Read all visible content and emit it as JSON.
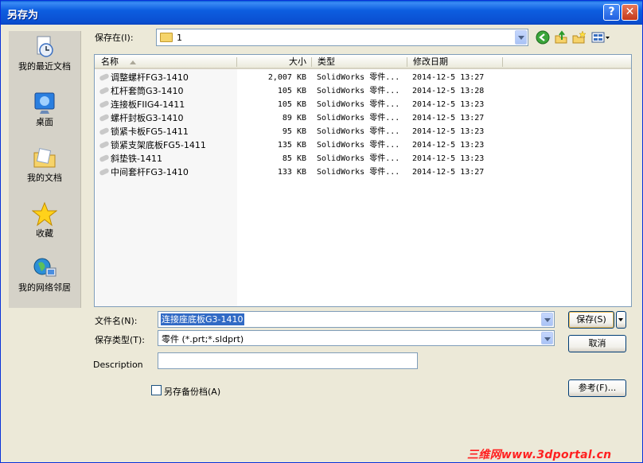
{
  "window": {
    "title": "另存为",
    "help": "?",
    "close": "✕"
  },
  "places": [
    {
      "id": "recent",
      "label": "我的最近文档"
    },
    {
      "id": "desktop",
      "label": "桌面"
    },
    {
      "id": "mydocs",
      "label": "我的文档"
    },
    {
      "id": "favorites",
      "label": "收藏"
    },
    {
      "id": "network",
      "label": "我的网络邻居"
    }
  ],
  "save_in": {
    "label": "保存在(I):",
    "value": "1"
  },
  "toolbar_icons": [
    "back-icon",
    "up-folder-icon",
    "new-folder-icon",
    "views-menu-icon"
  ],
  "columns": {
    "name": "名称",
    "size": "大小",
    "type": "类型",
    "modified": "修改日期"
  },
  "files": [
    {
      "name": "调整螺杆FG3-1410",
      "size": "2,007 KB",
      "type": "SolidWorks 零件...",
      "date": "2014-12-5 13:27"
    },
    {
      "name": "杠杆套筒G3-1410",
      "size": "105 KB",
      "type": "SolidWorks 零件...",
      "date": "2014-12-5 13:28"
    },
    {
      "name": "连接板FIIG4-1411",
      "size": "105 KB",
      "type": "SolidWorks 零件...",
      "date": "2014-12-5 13:23"
    },
    {
      "name": "螺杆封板G3-1410",
      "size": "89 KB",
      "type": "SolidWorks 零件...",
      "date": "2014-12-5 13:27"
    },
    {
      "name": "锁紧卡板FG5-1411",
      "size": "95 KB",
      "type": "SolidWorks 零件...",
      "date": "2014-12-5 13:23"
    },
    {
      "name": "锁紧支架底板FG5-1411",
      "size": "135 KB",
      "type": "SolidWorks 零件...",
      "date": "2014-12-5 13:23"
    },
    {
      "name": "斜垫铁-1411",
      "size": "85 KB",
      "type": "SolidWorks 零件...",
      "date": "2014-12-5 13:23"
    },
    {
      "name": "中间套杆FG3-1410",
      "size": "133 KB",
      "type": "SolidWorks 零件...",
      "date": "2014-12-5 13:27"
    }
  ],
  "form": {
    "filename_label": "文件名(N):",
    "filename_value": "连接座底板G3-1410",
    "filetype_label": "保存类型(T):",
    "filetype_value": "零件 (*.prt;*.sldprt)",
    "description_label": "Description",
    "description_value": "",
    "backup_label": "另存备份档(A)"
  },
  "buttons": {
    "save": "保存(S)",
    "cancel": "取消",
    "reference": "参考(F)..."
  },
  "watermark": "三维网www.3dportal.cn",
  "colors": {
    "titlebar": "#0a5fd8",
    "dialog_bg": "#ece9d8",
    "selection": "#316ac5",
    "watermark": "#ff2020"
  }
}
